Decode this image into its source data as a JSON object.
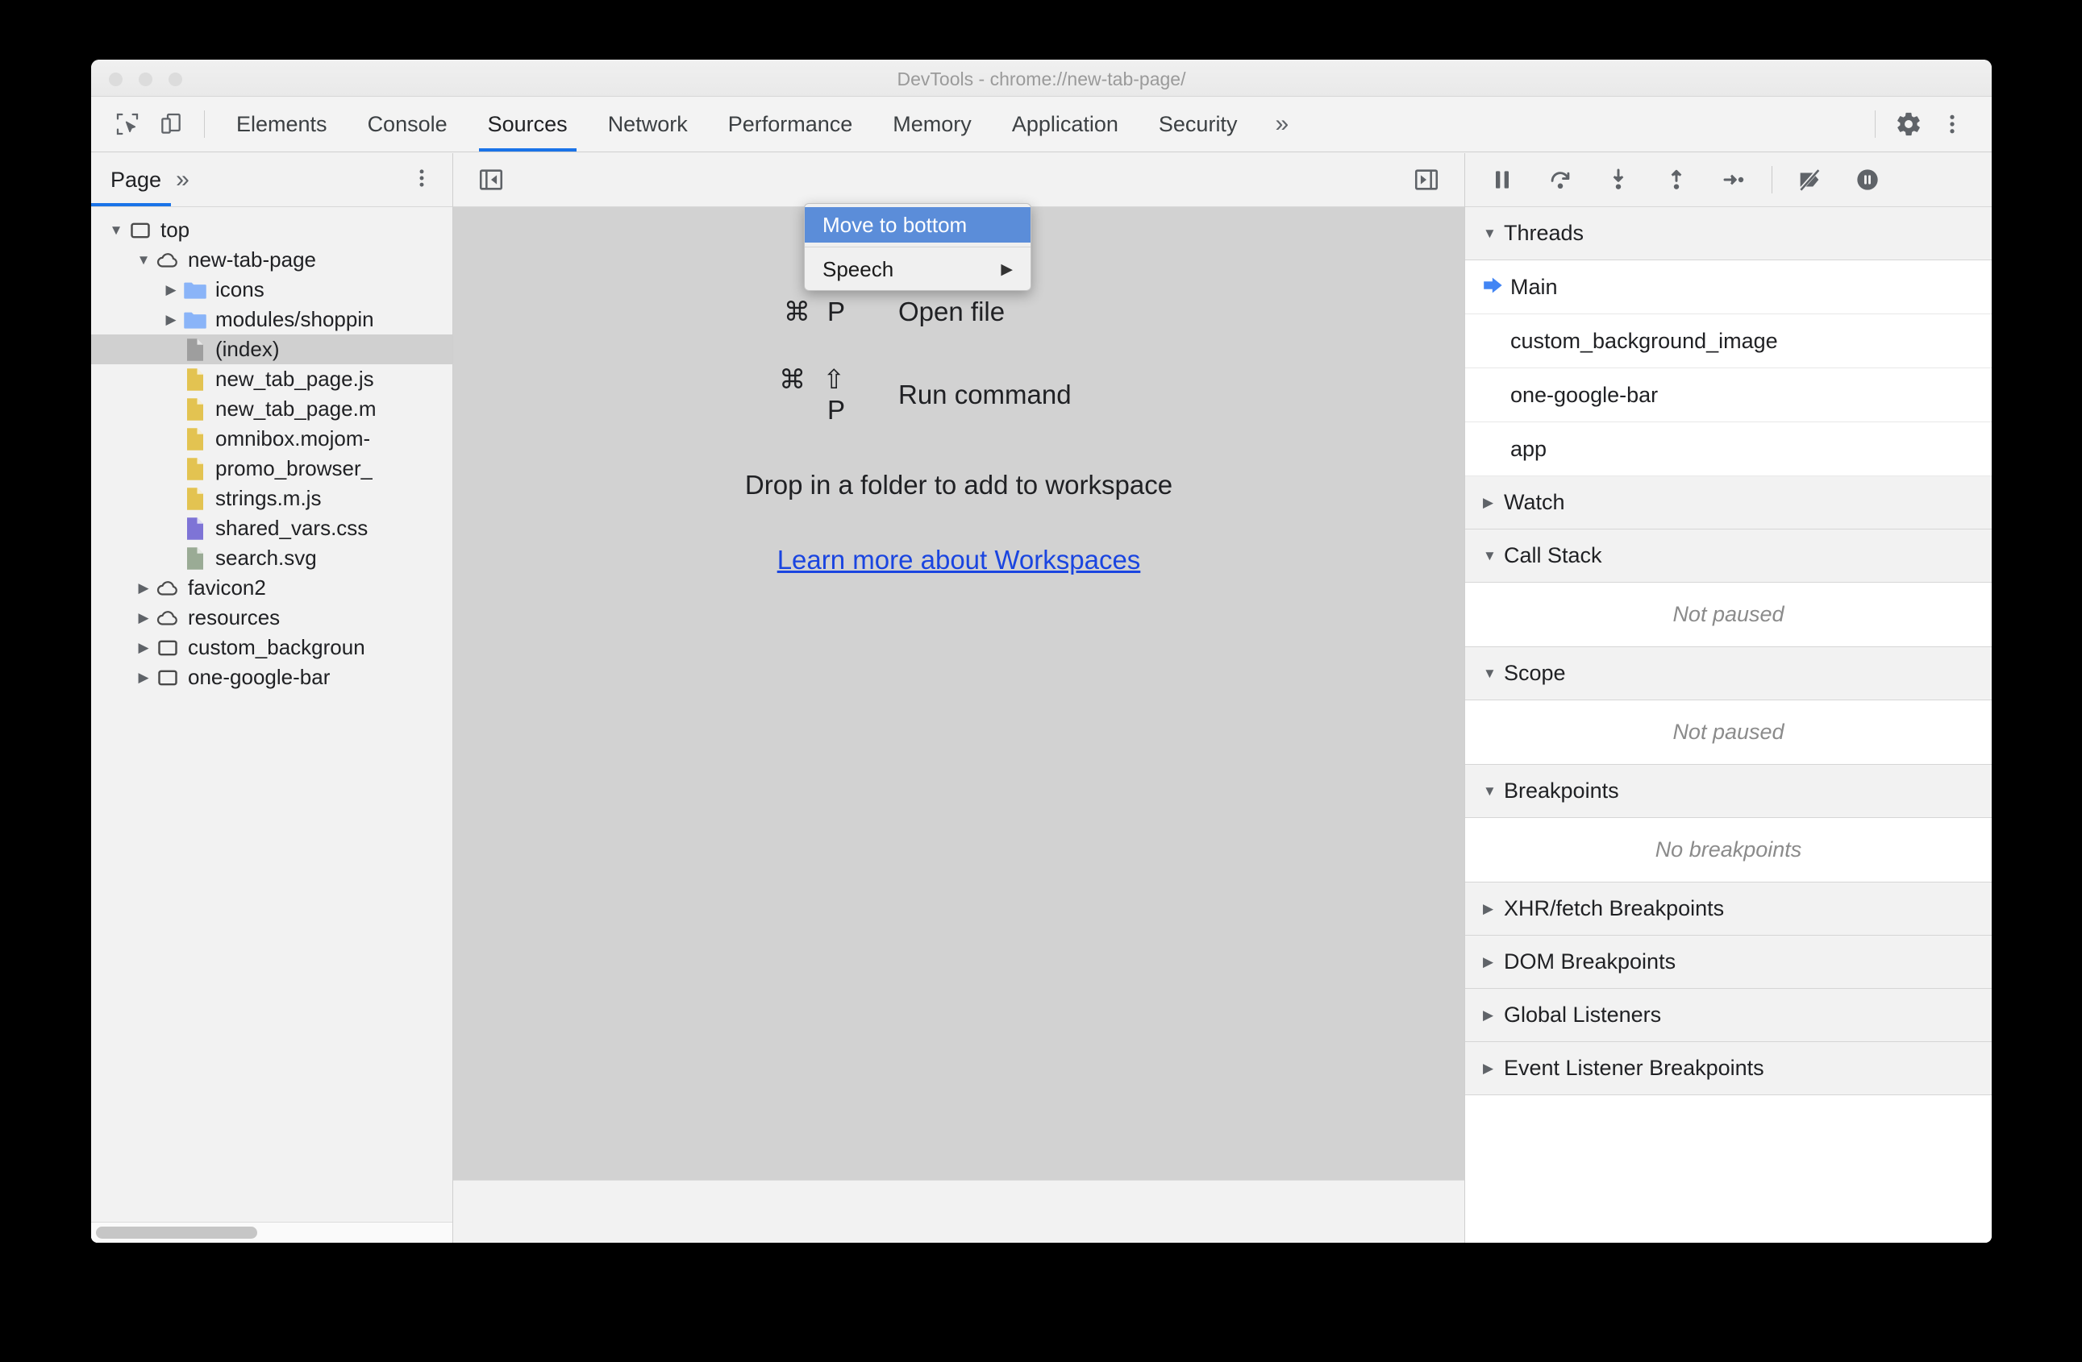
{
  "window": {
    "title": "DevTools - chrome://new-tab-page/"
  },
  "toolbar": {
    "inspect_icon": "inspect-element-icon",
    "device_icon": "device-toolbar-icon",
    "tabs": [
      {
        "label": "Elements",
        "active": false
      },
      {
        "label": "Console",
        "active": false
      },
      {
        "label": "Sources",
        "active": true
      },
      {
        "label": "Network",
        "active": false
      },
      {
        "label": "Performance",
        "active": false
      },
      {
        "label": "Memory",
        "active": false
      },
      {
        "label": "Application",
        "active": false
      },
      {
        "label": "Security",
        "active": false
      }
    ],
    "more_tabs": "»",
    "settings_icon": "gear-icon",
    "main_menu_icon": "three-dot-menu-icon"
  },
  "context_menu": {
    "items": [
      {
        "label": "Move to bottom",
        "highlighted": true,
        "submenu": false
      },
      {
        "label": "Speech",
        "highlighted": false,
        "submenu": true
      }
    ],
    "submenu_arrow": "▶"
  },
  "navigator": {
    "tab_label": "Page",
    "more_tabs": "»",
    "more_options_icon": "three-dot-menu-icon",
    "tree": [
      {
        "label": "top",
        "indent": 0,
        "icon": "frame",
        "twisty": "down",
        "selected": false
      },
      {
        "label": "new-tab-page",
        "indent": 1,
        "icon": "cloud",
        "twisty": "down",
        "selected": false
      },
      {
        "label": "icons",
        "indent": 2,
        "icon": "folder",
        "twisty": "right",
        "selected": false
      },
      {
        "label": "modules/shoppin",
        "indent": 2,
        "icon": "folder",
        "twisty": "right",
        "selected": false
      },
      {
        "label": "(index)",
        "indent": 2,
        "icon": "doc-gray",
        "twisty": "none",
        "selected": true
      },
      {
        "label": "new_tab_page.js",
        "indent": 2,
        "icon": "doc-yellow",
        "twisty": "none",
        "selected": false
      },
      {
        "label": "new_tab_page.m",
        "indent": 2,
        "icon": "doc-yellow",
        "twisty": "none",
        "selected": false
      },
      {
        "label": "omnibox.mojom-",
        "indent": 2,
        "icon": "doc-yellow",
        "twisty": "none",
        "selected": false
      },
      {
        "label": "promo_browser_",
        "indent": 2,
        "icon": "doc-yellow",
        "twisty": "none",
        "selected": false
      },
      {
        "label": "strings.m.js",
        "indent": 2,
        "icon": "doc-yellow",
        "twisty": "none",
        "selected": false
      },
      {
        "label": "shared_vars.css",
        "indent": 2,
        "icon": "doc-purple",
        "twisty": "none",
        "selected": false
      },
      {
        "label": "search.svg",
        "indent": 2,
        "icon": "doc-green",
        "twisty": "none",
        "selected": false
      },
      {
        "label": "favicon2",
        "indent": 1,
        "icon": "cloud",
        "twisty": "right",
        "selected": false
      },
      {
        "label": "resources",
        "indent": 1,
        "icon": "cloud",
        "twisty": "right",
        "selected": false
      },
      {
        "label": "custom_backgroun",
        "indent": 1,
        "icon": "frame",
        "twisty": "right",
        "selected": false
      },
      {
        "label": "one-google-bar",
        "indent": 1,
        "icon": "frame",
        "twisty": "right",
        "selected": false
      }
    ]
  },
  "editor": {
    "collapse_navigator_icon": "collapse-sidebar-icon",
    "show_debugger_icon": "expand-debugger-icon",
    "shortcuts": [
      {
        "keys": "⌘ P",
        "description": "Open file"
      },
      {
        "keys": "⌘ ⇧ P",
        "description": "Run command"
      }
    ],
    "drop_message": "Drop in a folder to add to workspace",
    "learn_more_link": "Learn more about Workspaces"
  },
  "debugger": {
    "buttons": [
      {
        "name": "resume-script-execution",
        "icon": "pause-icon"
      },
      {
        "name": "step-over-next-function-call",
        "icon": "step-over-icon"
      },
      {
        "name": "step-into-next-function-call",
        "icon": "step-into-icon"
      },
      {
        "name": "step-out-of-current-function",
        "icon": "step-out-icon"
      },
      {
        "name": "step",
        "icon": "step-icon"
      },
      {
        "name": "deactivate-breakpoints",
        "icon": "deactivate-breakpoints-icon"
      },
      {
        "name": "pause-on-exceptions",
        "icon": "pause-on-exceptions-icon"
      }
    ],
    "sections": [
      {
        "title": "Threads",
        "expanded": true,
        "type": "threads"
      },
      {
        "title": "Watch",
        "expanded": false,
        "type": "header-only"
      },
      {
        "title": "Call Stack",
        "expanded": true,
        "type": "empty",
        "empty_text": "Not paused"
      },
      {
        "title": "Scope",
        "expanded": true,
        "type": "empty",
        "empty_text": "Not paused"
      },
      {
        "title": "Breakpoints",
        "expanded": true,
        "type": "empty",
        "empty_text": "No breakpoints"
      },
      {
        "title": "XHR/fetch Breakpoints",
        "expanded": false,
        "type": "header-only"
      },
      {
        "title": "DOM Breakpoints",
        "expanded": false,
        "type": "header-only"
      },
      {
        "title": "Global Listeners",
        "expanded": false,
        "type": "header-only"
      },
      {
        "title": "Event Listener Breakpoints",
        "expanded": false,
        "type": "header-only"
      }
    ],
    "threads": [
      {
        "label": "Main",
        "selected": true
      },
      {
        "label": "custom_background_image",
        "selected": false
      },
      {
        "label": "one-google-bar",
        "selected": false
      },
      {
        "label": "app",
        "selected": false
      }
    ]
  },
  "colors": {
    "accent": "#1a73e8",
    "menu_highlight": "#5b8dd9",
    "link": "#1a45e0",
    "editor_bg": "#d2d2d2"
  }
}
